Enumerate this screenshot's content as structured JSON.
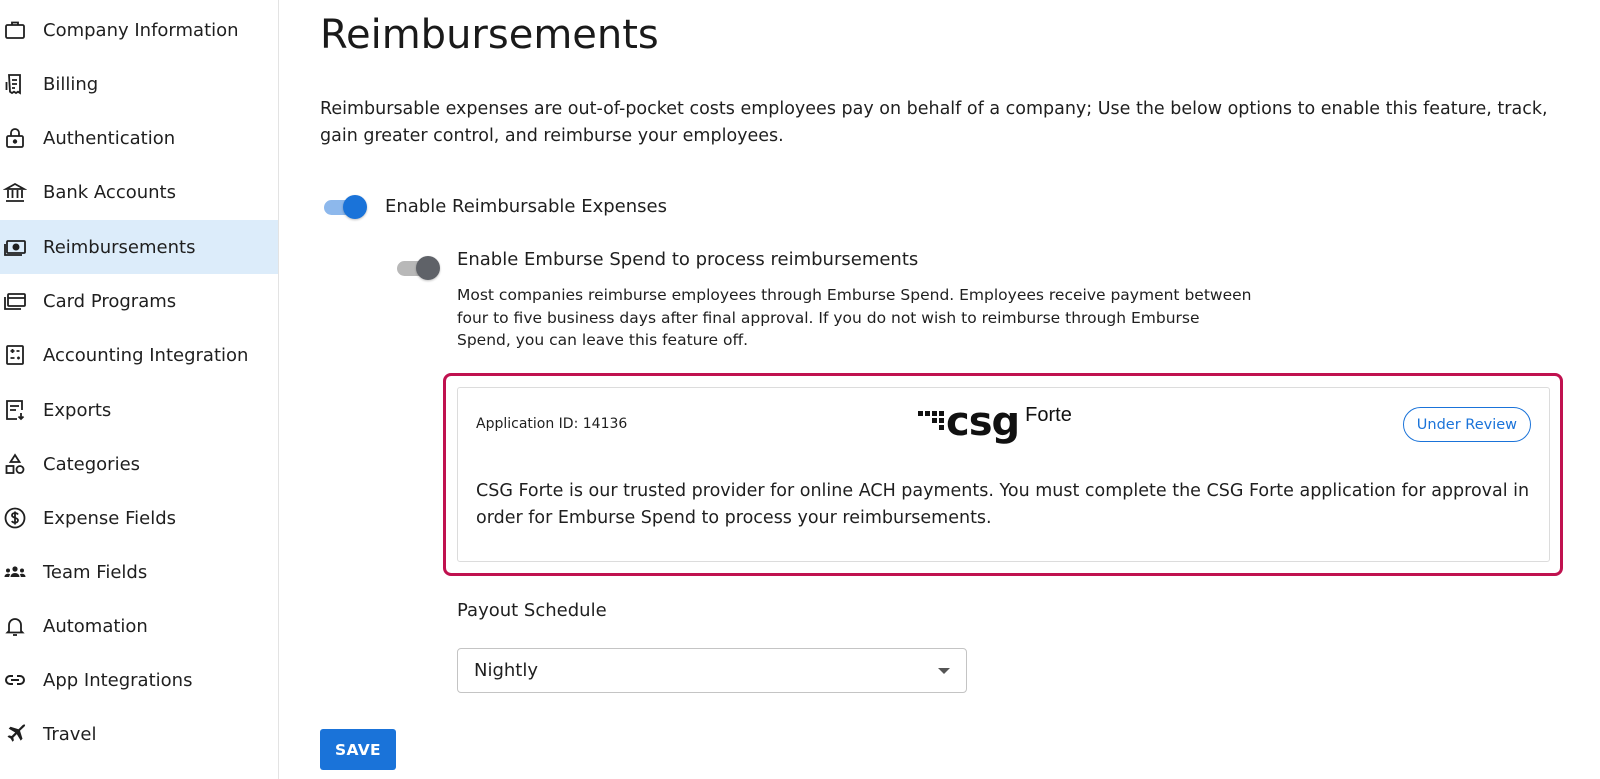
{
  "sidebar": {
    "items": [
      {
        "label": "Company Information",
        "icon": "briefcase-icon"
      },
      {
        "label": "Billing",
        "icon": "receipt-icon"
      },
      {
        "label": "Authentication",
        "icon": "lock-icon"
      },
      {
        "label": "Bank Accounts",
        "icon": "bank-icon"
      },
      {
        "label": "Reimbursements",
        "icon": "money-icon",
        "active": true
      },
      {
        "label": "Card Programs",
        "icon": "cards-icon"
      },
      {
        "label": "Accounting Integration",
        "icon": "calculator-icon"
      },
      {
        "label": "Exports",
        "icon": "export-icon"
      },
      {
        "label": "Categories",
        "icon": "shapes-icon"
      },
      {
        "label": "Expense Fields",
        "icon": "dollar-circle-icon"
      },
      {
        "label": "Team Fields",
        "icon": "team-icon"
      },
      {
        "label": "Automation",
        "icon": "bell-icon"
      },
      {
        "label": "App Integrations",
        "icon": "link-icon"
      },
      {
        "label": "Travel",
        "icon": "airplane-icon"
      }
    ]
  },
  "main": {
    "title": "Reimbursements",
    "intro": "Reimbursable expenses are out-of-pocket costs employees pay on behalf of a company; Use the below options to enable this feature, track, gain greater control, and reimburse your employees.",
    "toggle_reimbursable": {
      "label": "Enable Reimbursable Expenses",
      "state": "on"
    },
    "toggle_emburse": {
      "label": "Enable Emburse Spend to process reimbursements",
      "state": "off"
    },
    "emburse_help": "Most companies reimburse employees through Emburse Spend. Employees receive payment between four to five business days after final approval. If you do not wish to reimburse through Emburse Spend, you can leave this feature off.",
    "provider_card": {
      "application_id": "Application ID: 14136",
      "logo_main": "csg",
      "logo_sub": "Forte",
      "status": "Under Review",
      "description": "CSG Forte is our trusted provider for online ACH payments. You must complete the CSG Forte application for approval in order for Emburse Spend to process your reimbursements."
    },
    "payout": {
      "label": "Payout Schedule",
      "selected": "Nightly"
    },
    "save_label": "SAVE"
  },
  "colors": {
    "accent": "#1a73d9",
    "active_nav_bg": "#dcecfa",
    "highlight_border": "#c0114f"
  }
}
